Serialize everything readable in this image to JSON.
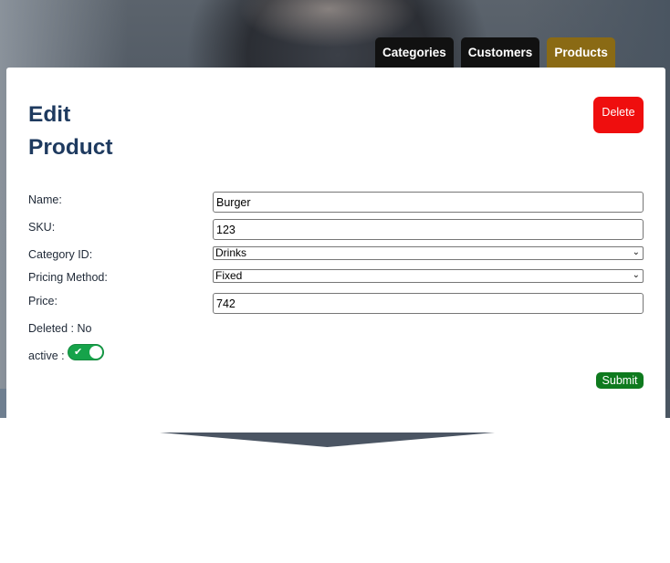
{
  "nav": {
    "tabs": [
      {
        "label": "Categories",
        "active": false
      },
      {
        "label": "Customers",
        "active": false
      },
      {
        "label": "Products",
        "active": true
      }
    ]
  },
  "form": {
    "title_line1": "Edit",
    "title_line2": "Product",
    "delete_label": "Delete",
    "name_label": "Name:",
    "name_value": "Burger",
    "sku_label": "SKU:",
    "sku_value": "123",
    "category_label": "Category ID:",
    "category_value": "Drinks",
    "pricing_label": "Pricing Method:",
    "pricing_value": "Fixed",
    "price_label": "Price:",
    "price_value": "742",
    "deleted_text": "Deleted : No",
    "active_label": "active :",
    "active_on": true,
    "submit_label": "Submit"
  },
  "colors": {
    "title": "#1e3a5f",
    "active_tab": "#8a6a14",
    "delete": "#ef0e0e",
    "submit": "#0e7a1e",
    "toggle_on": "#16a34a"
  },
  "icons": {
    "toggle_check": "check-icon",
    "select_caret": "chevron-down-icon"
  }
}
